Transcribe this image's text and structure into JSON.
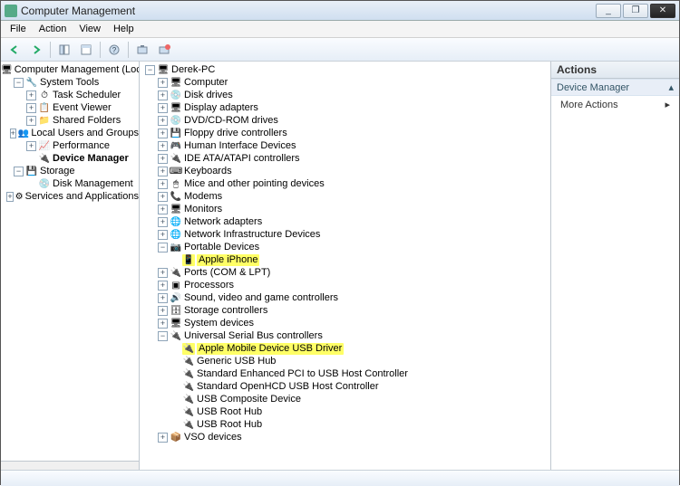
{
  "window": {
    "title": "Computer Management"
  },
  "menu": {
    "file": "File",
    "action": "Action",
    "view": "View",
    "help": "Help"
  },
  "leftTree": {
    "root": "Computer Management (Local",
    "systemTools": "System Tools",
    "taskScheduler": "Task Scheduler",
    "eventViewer": "Event Viewer",
    "sharedFolders": "Shared Folders",
    "localUsers": "Local Users and Groups",
    "performance": "Performance",
    "deviceManager": "Device Manager",
    "storage": "Storage",
    "diskManagement": "Disk Management",
    "services": "Services and Applications"
  },
  "midTree": {
    "root": "Derek-PC",
    "items": {
      "computer": "Computer",
      "diskDrives": "Disk drives",
      "displayAdapters": "Display adapters",
      "dvd": "DVD/CD-ROM drives",
      "floppy": "Floppy drive controllers",
      "hid": "Human Interface Devices",
      "ide": "IDE ATA/ATAPI controllers",
      "keyboards": "Keyboards",
      "mice": "Mice and other pointing devices",
      "modems": "Modems",
      "monitors": "Monitors",
      "netAdapters": "Network adapters",
      "netInfra": "Network Infrastructure Devices",
      "portable": "Portable Devices",
      "appleIphone": "Apple iPhone",
      "ports": "Ports (COM & LPT)",
      "processors": "Processors",
      "sound": "Sound, video and game controllers",
      "storageCtl": "Storage controllers",
      "sysDevices": "System devices",
      "usb": "Universal Serial Bus controllers",
      "usbApple": "Apple Mobile Device USB Driver",
      "usbGeneric": "Generic USB Hub",
      "usbEnh": "Standard Enhanced PCI to USB Host Controller",
      "usbOpen": "Standard OpenHCD USB Host Controller",
      "usbComp": "USB Composite Device",
      "usbRoot1": "USB Root Hub",
      "usbRoot2": "USB Root Hub",
      "vso": "VSO devices"
    }
  },
  "actions": {
    "header": "Actions",
    "selected": "Device Manager",
    "more": "More Actions"
  }
}
